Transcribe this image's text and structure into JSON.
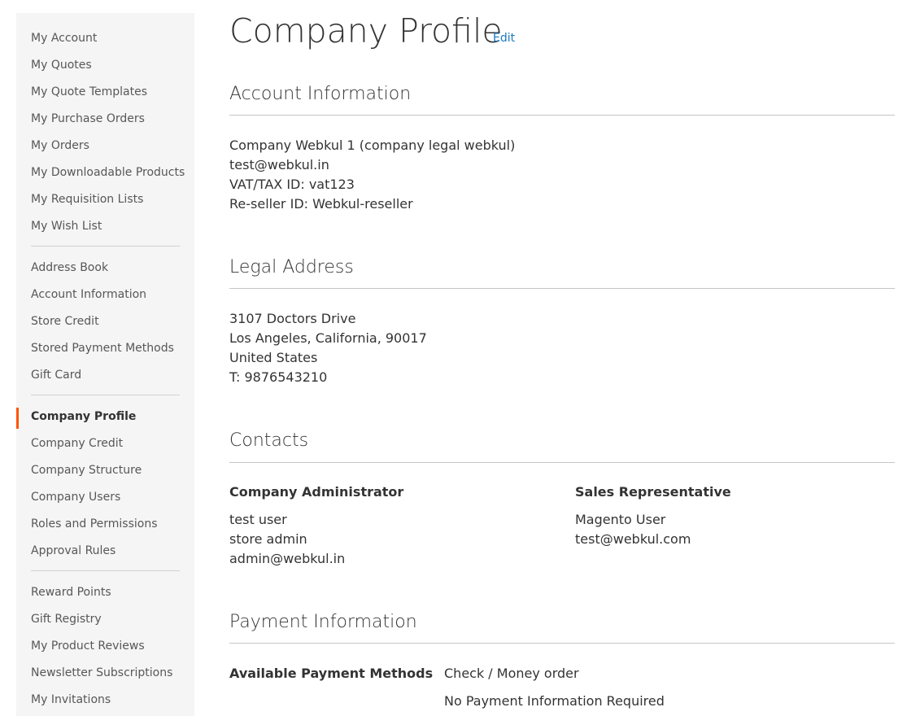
{
  "sidebar": {
    "groups": [
      [
        "My Account",
        "My Quotes",
        "My Quote Templates",
        "My Purchase Orders",
        "My Orders",
        "My Downloadable Products",
        "My Requisition Lists",
        "My Wish List"
      ],
      [
        "Address Book",
        "Account Information",
        "Store Credit",
        "Stored Payment Methods",
        "Gift Card"
      ],
      [
        "Company Profile",
        "Company Credit",
        "Company Structure",
        "Company Users",
        "Roles and Permissions",
        "Approval Rules"
      ],
      [
        "Reward Points",
        "Gift Registry",
        "My Product Reviews",
        "Newsletter Subscriptions",
        "My Invitations"
      ]
    ],
    "current": "Company Profile"
  },
  "page": {
    "title": "Company Profile",
    "edit_label": "Edit"
  },
  "account_info": {
    "title": "Account Information",
    "lines": [
      "Company Webkul 1 (company legal webkul)",
      "test@webkul.in",
      "VAT/TAX ID: vat123",
      "Re-seller ID: Webkul-reseller"
    ]
  },
  "legal_address": {
    "title": "Legal Address",
    "lines": [
      "3107 Doctors Drive",
      "Los Angeles, California, 90017",
      "United States",
      "T: 9876543210"
    ]
  },
  "contacts": {
    "title": "Contacts",
    "admin": {
      "heading": "Company Administrator",
      "lines": [
        "test user",
        "store admin",
        "admin@webkul.in"
      ]
    },
    "sales": {
      "heading": "Sales Representative",
      "lines": [
        "Magento User",
        "test@webkul.com"
      ]
    }
  },
  "payment": {
    "title": "Payment Information",
    "label": "Available Payment Methods",
    "methods": [
      "Check / Money order",
      "No Payment Information Required"
    ]
  }
}
